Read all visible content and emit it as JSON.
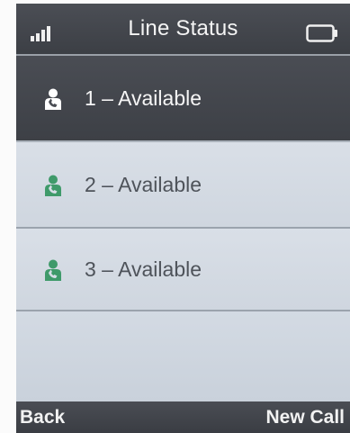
{
  "header": {
    "title": "Line Status",
    "signal_icon": "signal-strength-icon",
    "battery_icon": "battery-icon"
  },
  "lines": [
    {
      "label": "1 – Available",
      "icon": "phone-user-icon",
      "icon_color": "#ffffff",
      "selected": true
    },
    {
      "label": "2 – Available",
      "icon": "phone-user-icon",
      "icon_color": "#3f9a6a",
      "selected": false
    },
    {
      "label": "3 – Available",
      "icon": "phone-user-icon",
      "icon_color": "#3f9a6a",
      "selected": false
    }
  ],
  "softkeys": {
    "left": "Back",
    "right": "New Call"
  },
  "colors": {
    "accent_green": "#3f9a6a",
    "bar_dark": "#43464c",
    "list_bg": "#d6dde6"
  }
}
